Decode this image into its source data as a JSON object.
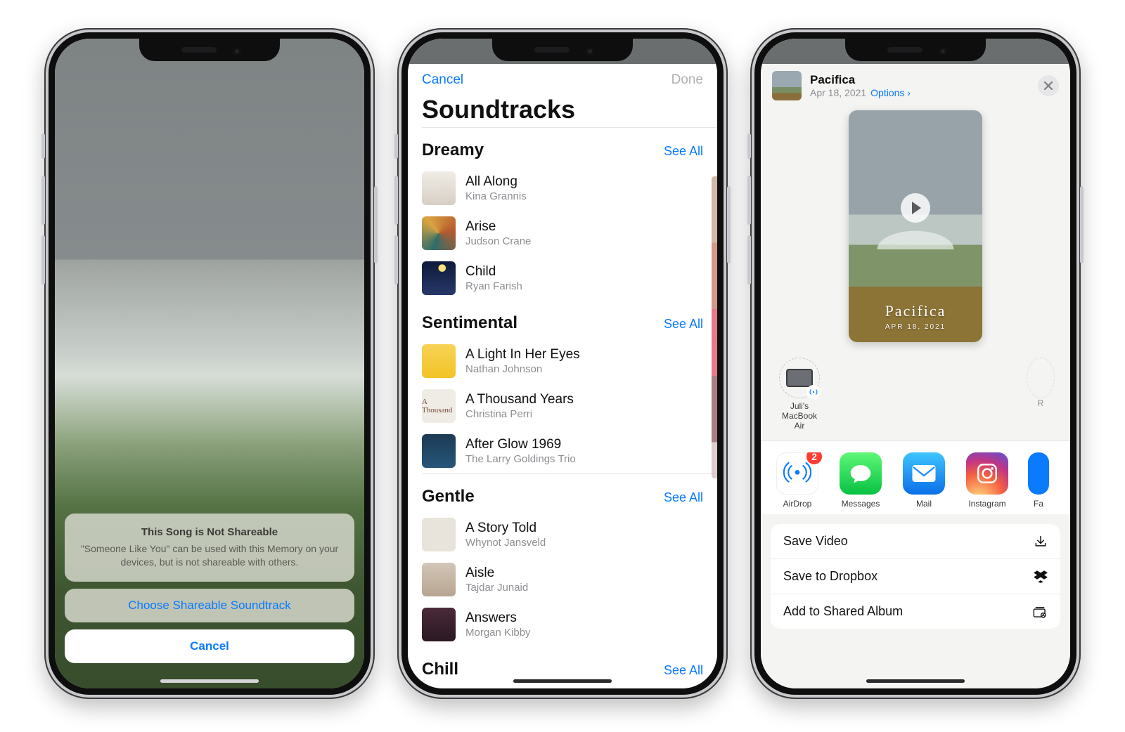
{
  "phone1": {
    "alert": {
      "title": "This Song is Not Shareable",
      "body": "\"Someone Like You\" can be used with this Memory on your devices, but is not shareable with others.",
      "choose": "Choose Shareable Soundtrack",
      "cancel": "Cancel"
    }
  },
  "phone2": {
    "nav": {
      "cancel": "Cancel",
      "done": "Done"
    },
    "title": "Soundtracks",
    "see_all": "See All",
    "sections": {
      "dreamy": {
        "name": "Dreamy",
        "tracks": [
          {
            "title": "All Along",
            "artist": "Kina Grannis"
          },
          {
            "title": "Arise",
            "artist": "Judson Crane"
          },
          {
            "title": "Child",
            "artist": "Ryan Farish"
          }
        ]
      },
      "sentimental": {
        "name": "Sentimental",
        "tracks": [
          {
            "title": "A Light In Her Eyes",
            "artist": "Nathan Johnson"
          },
          {
            "title": "A Thousand Years",
            "artist": "Christina Perri"
          },
          {
            "title": "After Glow 1969",
            "artist": "The Larry Goldings Trio"
          }
        ]
      },
      "gentle": {
        "name": "Gentle",
        "tracks": [
          {
            "title": "A Story Told",
            "artist": "Whynot Jansveld"
          },
          {
            "title": "Aisle",
            "artist": "Tajdar Junaid"
          },
          {
            "title": "Answers",
            "artist": "Morgan Kibby"
          }
        ]
      },
      "chill": {
        "name": "Chill"
      }
    }
  },
  "phone3": {
    "header": {
      "name": "Pacifica",
      "date": "Apr 18, 2021",
      "options": "Options"
    },
    "preview": {
      "title": "Pacifica",
      "date": "APR 18, 2021"
    },
    "airdrop": {
      "device_line1": "Juli's",
      "device_line2": "MacBook Air",
      "partial": "R"
    },
    "apps": {
      "airdrop": {
        "label": "AirDrop",
        "badge": "2"
      },
      "messages": {
        "label": "Messages"
      },
      "mail": {
        "label": "Mail"
      },
      "instagram": {
        "label": "Instagram"
      },
      "more": {
        "label": "Fa"
      }
    },
    "actions": {
      "save_video": "Save Video",
      "save_dropbox": "Save to Dropbox",
      "add_shared": "Add to Shared Album"
    }
  }
}
